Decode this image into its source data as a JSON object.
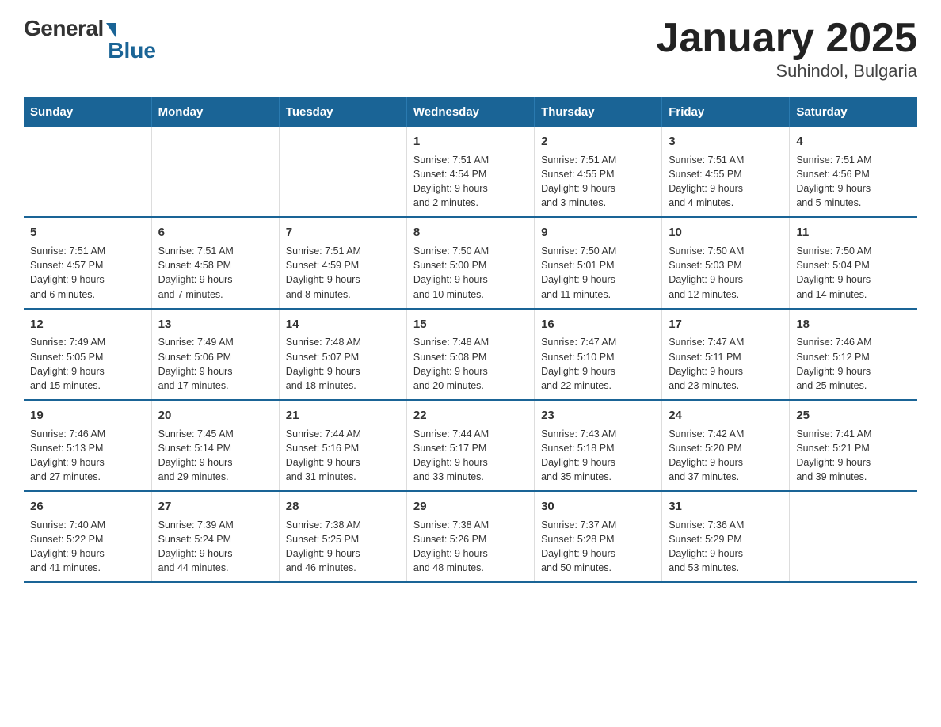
{
  "logo": {
    "general": "General",
    "blue": "Blue"
  },
  "title": "January 2025",
  "subtitle": "Suhindol, Bulgaria",
  "weekdays": [
    "Sunday",
    "Monday",
    "Tuesday",
    "Wednesday",
    "Thursday",
    "Friday",
    "Saturday"
  ],
  "weeks": [
    [
      {
        "day": "",
        "info": ""
      },
      {
        "day": "",
        "info": ""
      },
      {
        "day": "",
        "info": ""
      },
      {
        "day": "1",
        "info": "Sunrise: 7:51 AM\nSunset: 4:54 PM\nDaylight: 9 hours\nand 2 minutes."
      },
      {
        "day": "2",
        "info": "Sunrise: 7:51 AM\nSunset: 4:55 PM\nDaylight: 9 hours\nand 3 minutes."
      },
      {
        "day": "3",
        "info": "Sunrise: 7:51 AM\nSunset: 4:55 PM\nDaylight: 9 hours\nand 4 minutes."
      },
      {
        "day": "4",
        "info": "Sunrise: 7:51 AM\nSunset: 4:56 PM\nDaylight: 9 hours\nand 5 minutes."
      }
    ],
    [
      {
        "day": "5",
        "info": "Sunrise: 7:51 AM\nSunset: 4:57 PM\nDaylight: 9 hours\nand 6 minutes."
      },
      {
        "day": "6",
        "info": "Sunrise: 7:51 AM\nSunset: 4:58 PM\nDaylight: 9 hours\nand 7 minutes."
      },
      {
        "day": "7",
        "info": "Sunrise: 7:51 AM\nSunset: 4:59 PM\nDaylight: 9 hours\nand 8 minutes."
      },
      {
        "day": "8",
        "info": "Sunrise: 7:50 AM\nSunset: 5:00 PM\nDaylight: 9 hours\nand 10 minutes."
      },
      {
        "day": "9",
        "info": "Sunrise: 7:50 AM\nSunset: 5:01 PM\nDaylight: 9 hours\nand 11 minutes."
      },
      {
        "day": "10",
        "info": "Sunrise: 7:50 AM\nSunset: 5:03 PM\nDaylight: 9 hours\nand 12 minutes."
      },
      {
        "day": "11",
        "info": "Sunrise: 7:50 AM\nSunset: 5:04 PM\nDaylight: 9 hours\nand 14 minutes."
      }
    ],
    [
      {
        "day": "12",
        "info": "Sunrise: 7:49 AM\nSunset: 5:05 PM\nDaylight: 9 hours\nand 15 minutes."
      },
      {
        "day": "13",
        "info": "Sunrise: 7:49 AM\nSunset: 5:06 PM\nDaylight: 9 hours\nand 17 minutes."
      },
      {
        "day": "14",
        "info": "Sunrise: 7:48 AM\nSunset: 5:07 PM\nDaylight: 9 hours\nand 18 minutes."
      },
      {
        "day": "15",
        "info": "Sunrise: 7:48 AM\nSunset: 5:08 PM\nDaylight: 9 hours\nand 20 minutes."
      },
      {
        "day": "16",
        "info": "Sunrise: 7:47 AM\nSunset: 5:10 PM\nDaylight: 9 hours\nand 22 minutes."
      },
      {
        "day": "17",
        "info": "Sunrise: 7:47 AM\nSunset: 5:11 PM\nDaylight: 9 hours\nand 23 minutes."
      },
      {
        "day": "18",
        "info": "Sunrise: 7:46 AM\nSunset: 5:12 PM\nDaylight: 9 hours\nand 25 minutes."
      }
    ],
    [
      {
        "day": "19",
        "info": "Sunrise: 7:46 AM\nSunset: 5:13 PM\nDaylight: 9 hours\nand 27 minutes."
      },
      {
        "day": "20",
        "info": "Sunrise: 7:45 AM\nSunset: 5:14 PM\nDaylight: 9 hours\nand 29 minutes."
      },
      {
        "day": "21",
        "info": "Sunrise: 7:44 AM\nSunset: 5:16 PM\nDaylight: 9 hours\nand 31 minutes."
      },
      {
        "day": "22",
        "info": "Sunrise: 7:44 AM\nSunset: 5:17 PM\nDaylight: 9 hours\nand 33 minutes."
      },
      {
        "day": "23",
        "info": "Sunrise: 7:43 AM\nSunset: 5:18 PM\nDaylight: 9 hours\nand 35 minutes."
      },
      {
        "day": "24",
        "info": "Sunrise: 7:42 AM\nSunset: 5:20 PM\nDaylight: 9 hours\nand 37 minutes."
      },
      {
        "day": "25",
        "info": "Sunrise: 7:41 AM\nSunset: 5:21 PM\nDaylight: 9 hours\nand 39 minutes."
      }
    ],
    [
      {
        "day": "26",
        "info": "Sunrise: 7:40 AM\nSunset: 5:22 PM\nDaylight: 9 hours\nand 41 minutes."
      },
      {
        "day": "27",
        "info": "Sunrise: 7:39 AM\nSunset: 5:24 PM\nDaylight: 9 hours\nand 44 minutes."
      },
      {
        "day": "28",
        "info": "Sunrise: 7:38 AM\nSunset: 5:25 PM\nDaylight: 9 hours\nand 46 minutes."
      },
      {
        "day": "29",
        "info": "Sunrise: 7:38 AM\nSunset: 5:26 PM\nDaylight: 9 hours\nand 48 minutes."
      },
      {
        "day": "30",
        "info": "Sunrise: 7:37 AM\nSunset: 5:28 PM\nDaylight: 9 hours\nand 50 minutes."
      },
      {
        "day": "31",
        "info": "Sunrise: 7:36 AM\nSunset: 5:29 PM\nDaylight: 9 hours\nand 53 minutes."
      },
      {
        "day": "",
        "info": ""
      }
    ]
  ]
}
